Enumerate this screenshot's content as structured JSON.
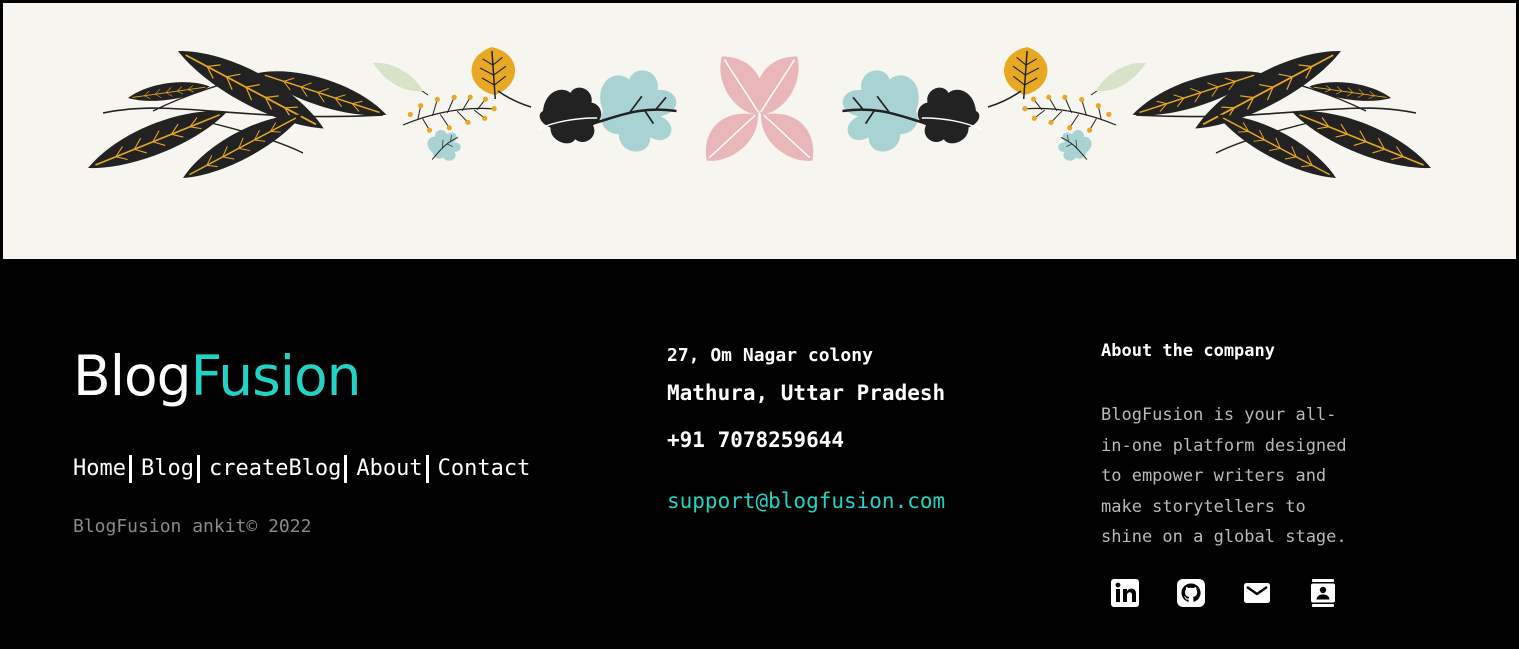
{
  "brand": {
    "name_part1": "Blog",
    "name_part2": "Fusion",
    "accent_color": "#22d3c5"
  },
  "nav": {
    "items": [
      {
        "label": "Home"
      },
      {
        "label": "Blog"
      },
      {
        "label": "createBlog"
      },
      {
        "label": "About"
      },
      {
        "label": "Contact"
      }
    ]
  },
  "copyright": "BlogFusion ankit© 2022",
  "contact": {
    "address_line1": "27, Om Nagar colony",
    "address_line2": "Mathura, Uttar Pradesh",
    "phone": "+91 7078259644",
    "email": "support@blogfusion.com"
  },
  "about": {
    "heading": "About the company",
    "text": "BlogFusion is your all-\nin-one platform designed\nto empower writers and\nmake storytellers to\nshine on a global stage."
  },
  "socials": [
    {
      "icon": "linkedin-icon"
    },
    {
      "icon": "github-icon"
    },
    {
      "icon": "mail-icon"
    },
    {
      "icon": "contact-card-icon"
    }
  ],
  "colors": {
    "banner_bg": "#f6f5ef",
    "footer_bg": "#000000",
    "leaf_dark": "#222222",
    "leaf_gold": "#e8a824",
    "leaf_teal": "#a9d3d3",
    "leaf_pink": "#eab7b9",
    "leaf_sage": "#d7e2c6"
  }
}
